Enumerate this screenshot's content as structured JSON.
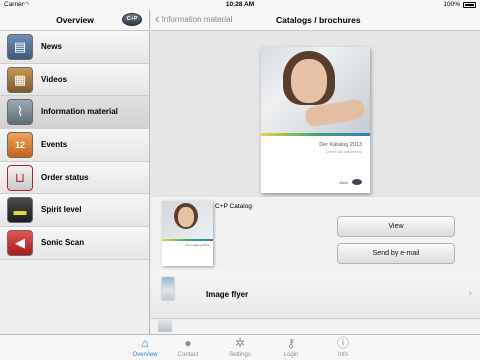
{
  "status_bar": {
    "carrier": "Carrier",
    "time": "10:28 AM",
    "battery": "100%"
  },
  "sidebar": {
    "title": "Overview",
    "logo_text": "C+P",
    "items": [
      {
        "label": "News",
        "icon": "book-icon",
        "color": "#4b6a8c"
      },
      {
        "label": "Videos",
        "icon": "film-icon",
        "color": "#8b6b3d"
      },
      {
        "label": "Information material",
        "icon": "paperclip-icon",
        "color": "#6d7c86"
      },
      {
        "label": "Events",
        "icon": "calendar-icon",
        "color": "#c86a2a"
      },
      {
        "label": "Order status",
        "icon": "cart-icon",
        "color": "#b8202a"
      },
      {
        "label": "Spirit level",
        "icon": "level-icon",
        "color": "#5e7d3f"
      },
      {
        "label": "Sonic Scan",
        "icon": "speaker-icon",
        "color": "#c82a2a"
      }
    ]
  },
  "navbar": {
    "back_label": "Information material",
    "title": "Catalogs / brochures"
  },
  "hero": {
    "cover_title": "Der Katalog 2013",
    "cover_subtitle": "Lernen Sie uns kennen",
    "cover_brand": "Markt",
    "cover_mark": "C+P"
  },
  "catalog": {
    "label": "C+P Catalog",
    "view_button": "View",
    "send_button": "Send by e-mail",
    "thumb_title": "Der Katalog 2013"
  },
  "flyer": {
    "label": "Image flyer",
    "chevron": "›"
  },
  "tabbar": {
    "tabs": [
      {
        "label": "Overview",
        "icon": "home-icon",
        "active": true
      },
      {
        "label": "Contact",
        "icon": "person-icon",
        "active": false
      },
      {
        "label": "Settings",
        "icon": "gear-icon",
        "active": false
      },
      {
        "label": "Login",
        "icon": "key-icon",
        "active": false
      },
      {
        "label": "Info",
        "icon": "info-icon",
        "active": false
      }
    ]
  },
  "colors": {
    "accent": "#2a7fd7",
    "active_row": "#d2d2d2"
  }
}
